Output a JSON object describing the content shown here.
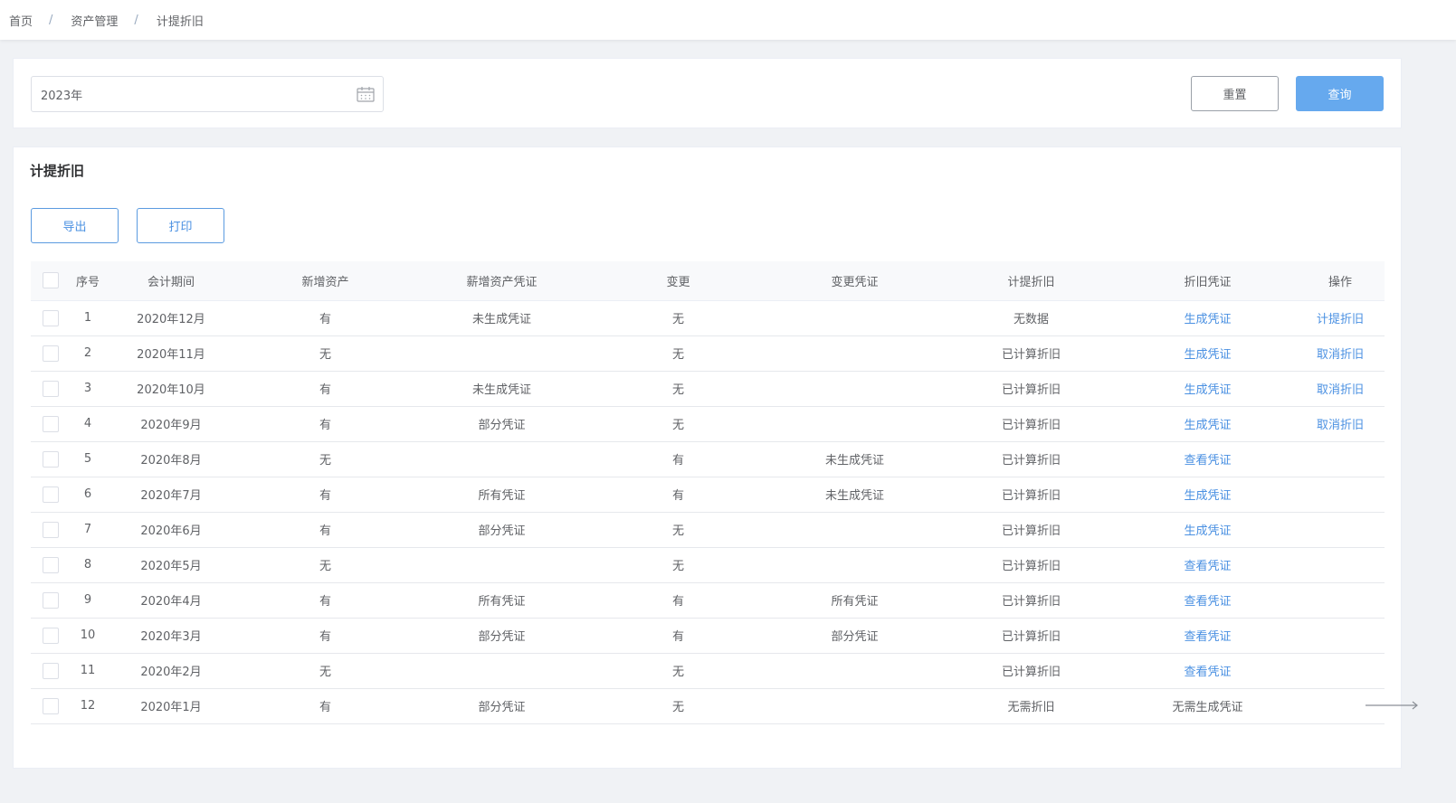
{
  "breadcrumb": {
    "home": "首页",
    "parent": "资产管理",
    "current": "计提折旧",
    "separator": "/"
  },
  "filter": {
    "date_value": "2023年",
    "reset_label": "重置",
    "query_label": "查询"
  },
  "card": {
    "title": "计提折旧",
    "export_label": "导出",
    "print_label": "打印"
  },
  "table": {
    "headers": [
      "序号",
      "会计期间",
      "新增资产",
      "薪增资产凭证",
      "变更",
      "变更凭证",
      "计提折旧",
      "折旧凭证",
      "操作"
    ],
    "rows": [
      {
        "no": "1",
        "period": "2020年12月",
        "new_asset": "有",
        "new_voucher": "未生成凭证",
        "change": "无",
        "change_voucher": "",
        "depr": "无数据",
        "depr_voucher": "生成凭证",
        "action": "计提折旧"
      },
      {
        "no": "2",
        "period": "2020年11月",
        "new_asset": "无",
        "new_voucher": "",
        "change": "无",
        "change_voucher": "",
        "depr": "已计算折旧",
        "depr_voucher": "生成凭证",
        "action": "取消折旧"
      },
      {
        "no": "3",
        "period": "2020年10月",
        "new_asset": "有",
        "new_voucher": "未生成凭证",
        "change": "无",
        "change_voucher": "",
        "depr": "已计算折旧",
        "depr_voucher": "生成凭证",
        "action": "取消折旧"
      },
      {
        "no": "4",
        "period": "2020年9月",
        "new_asset": "有",
        "new_voucher": "部分凭证",
        "change": "无",
        "change_voucher": "",
        "depr": "已计算折旧",
        "depr_voucher": "生成凭证",
        "action": "取消折旧"
      },
      {
        "no": "5",
        "period": "2020年8月",
        "new_asset": "无",
        "new_voucher": "",
        "change": "有",
        "change_voucher": "未生成凭证",
        "depr": "已计算折旧",
        "depr_voucher": "查看凭证",
        "action": ""
      },
      {
        "no": "6",
        "period": "2020年7月",
        "new_asset": "有",
        "new_voucher": "所有凭证",
        "change": "有",
        "change_voucher": "未生成凭证",
        "depr": "已计算折旧",
        "depr_voucher": "生成凭证",
        "action": ""
      },
      {
        "no": "7",
        "period": "2020年6月",
        "new_asset": "有",
        "new_voucher": "部分凭证",
        "change": "无",
        "change_voucher": "",
        "depr": "已计算折旧",
        "depr_voucher": "生成凭证",
        "action": ""
      },
      {
        "no": "8",
        "period": "2020年5月",
        "new_asset": "无",
        "new_voucher": "",
        "change": "无",
        "change_voucher": "",
        "depr": "已计算折旧",
        "depr_voucher": "查看凭证",
        "action": ""
      },
      {
        "no": "9",
        "period": "2020年4月",
        "new_asset": "有",
        "new_voucher": "所有凭证",
        "change": "有",
        "change_voucher": "所有凭证",
        "depr": "已计算折旧",
        "depr_voucher": "查看凭证",
        "action": ""
      },
      {
        "no": "10",
        "period": "2020年3月",
        "new_asset": "有",
        "new_voucher": "部分凭证",
        "change": "有",
        "change_voucher": "部分凭证",
        "depr": "已计算折旧",
        "depr_voucher": "查看凭证",
        "action": ""
      },
      {
        "no": "11",
        "period": "2020年2月",
        "new_asset": "无",
        "new_voucher": "",
        "change": "无",
        "change_voucher": "",
        "depr": "已计算折旧",
        "depr_voucher": "查看凭证",
        "action": ""
      },
      {
        "no": "12",
        "period": "2020年1月",
        "new_asset": "有",
        "new_voucher": "部分凭证",
        "change": "无",
        "change_voucher": "",
        "depr": "无需折旧",
        "depr_voucher": "无需生成凭证",
        "action": ""
      }
    ]
  },
  "colors": {
    "accent": "#4a90e2",
    "query_button": "#66a9ee",
    "background": "#f0f2f5"
  },
  "icons": {
    "date": "calendar-icon",
    "scroll": "arrow-right-icon"
  }
}
